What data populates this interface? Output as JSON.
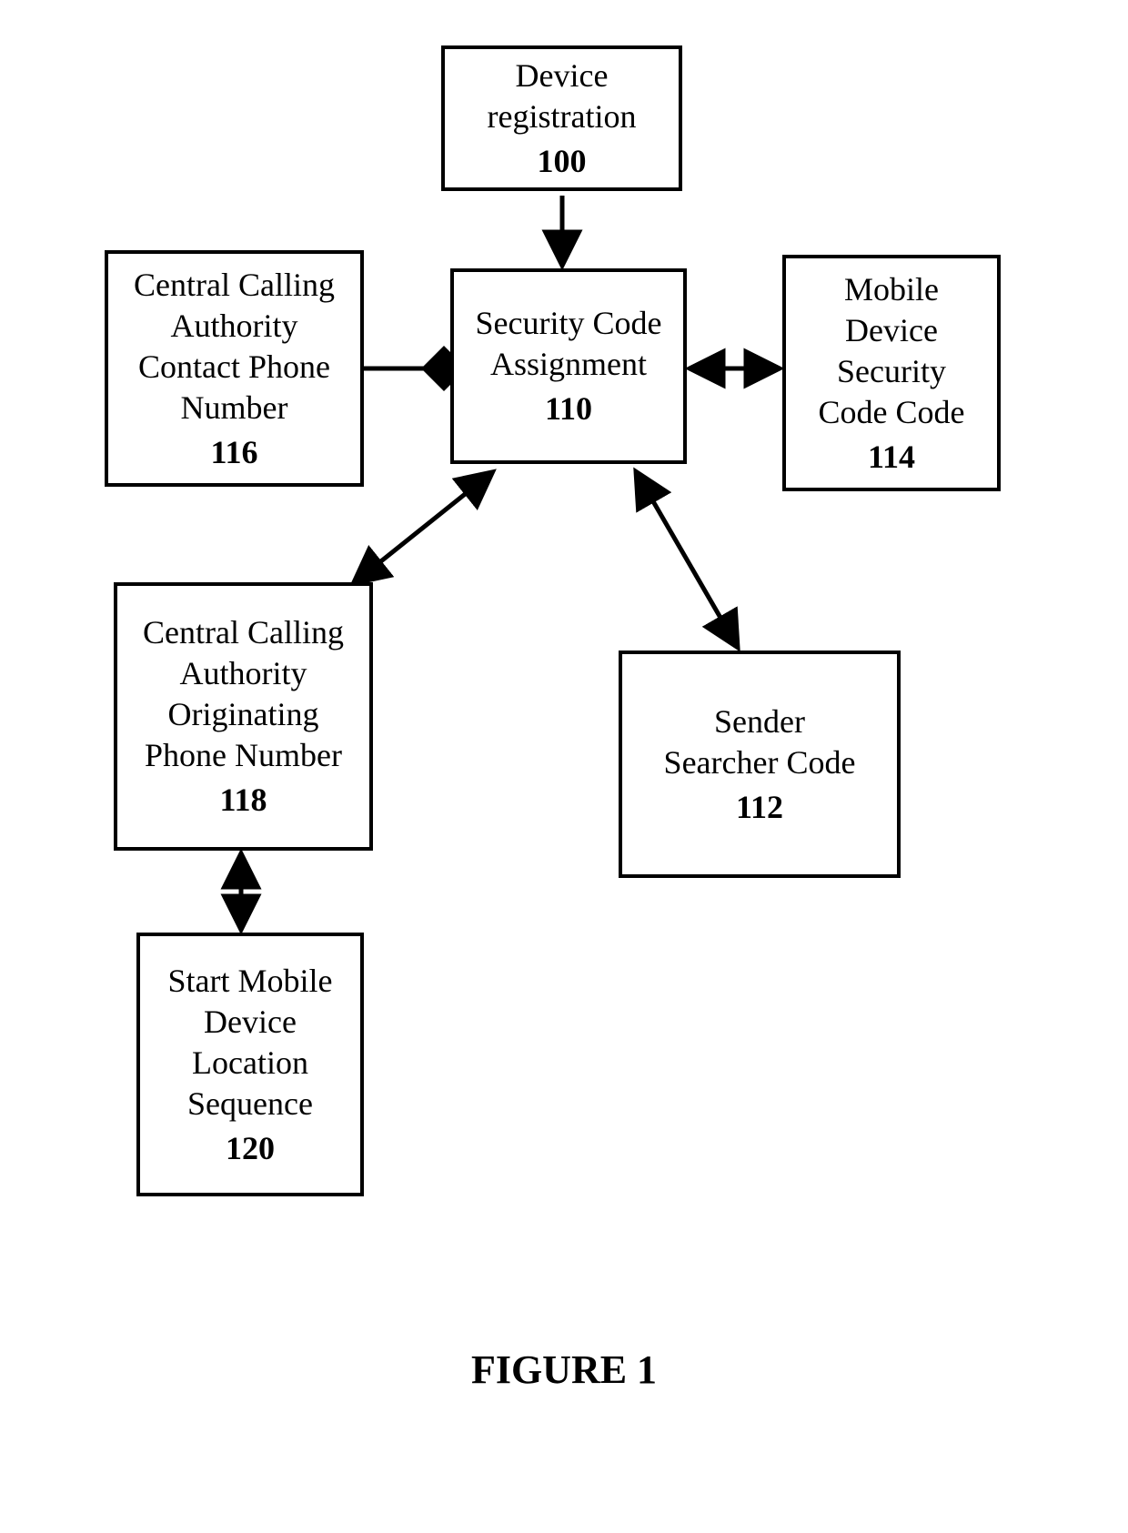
{
  "figure_caption": "FIGURE 1",
  "boxes": {
    "b100": {
      "label": "Device\nregistration",
      "ref": "100"
    },
    "b110": {
      "label": "Security Code\nAssignment",
      "ref": "110"
    },
    "b116": {
      "label": "Central Calling\nAuthority\nContact Phone\nNumber",
      "ref": "116"
    },
    "b114": {
      "label": "Mobile\nDevice\nSecurity\nCode Code",
      "ref": "114"
    },
    "b118": {
      "label": "Central Calling\nAuthority\nOriginating\nPhone Number",
      "ref": "118"
    },
    "b112": {
      "label": "Sender\nSearcher Code",
      "ref": "112"
    },
    "b120": {
      "label": "Start Mobile\nDevice\nLocation\nSequence",
      "ref": "120"
    }
  }
}
